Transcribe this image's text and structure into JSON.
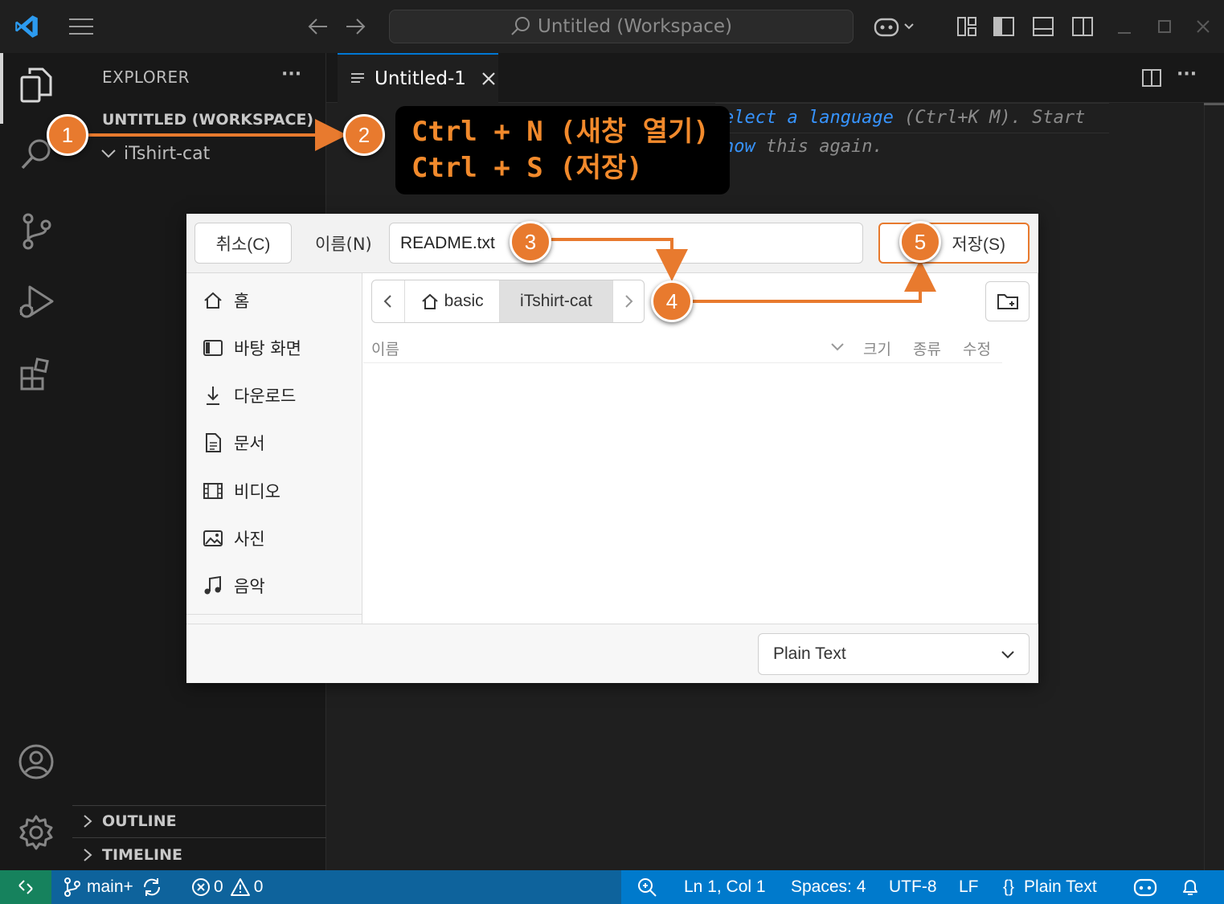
{
  "titlebar": {
    "search_text": "Untitled (Workspace)"
  },
  "sidebar": {
    "title": "EXPLORER",
    "more": "···",
    "workspace_label": "UNTITLED (WORKSPACE)",
    "folder": "iTshirt-cat",
    "outline": "OUTLINE",
    "timeline": "TIMELINE"
  },
  "editor": {
    "tab_label": "Untitled-1",
    "hint_line1_lang": "elect a language",
    "hint_line1_rest": " (Ctrl+K M). Start",
    "hint_line2_link": "how",
    "hint_line2_rest": " this again."
  },
  "dialog": {
    "cancel_label": "취소(C)",
    "name_label": "이름(N)",
    "filename": "README.txt",
    "save_label": "저장(S)",
    "places": [
      {
        "label": "홈",
        "icon": "home-icon"
      },
      {
        "label": "바탕 화면",
        "icon": "desktop-icon"
      },
      {
        "label": "다운로드",
        "icon": "download-icon"
      },
      {
        "label": "문서",
        "icon": "document-icon"
      },
      {
        "label": "비디오",
        "icon": "video-icon"
      },
      {
        "label": "사진",
        "icon": "picture-icon"
      },
      {
        "label": "음악",
        "icon": "music-icon"
      }
    ],
    "crumbs": [
      "basic",
      "iTshirt-cat"
    ],
    "columns": [
      "이름",
      "크기",
      "종류",
      "수정"
    ],
    "filter": "Plain Text"
  },
  "statusbar": {
    "branch": "main+",
    "errors": "0",
    "warnings": "0",
    "position": "Ln 1, Col 1",
    "spaces": "Spaces: 4",
    "encoding": "UTF-8",
    "eol": "LF",
    "language": "Plain Text"
  },
  "annotations": {
    "badges": [
      "1",
      "2",
      "3",
      "4",
      "5"
    ],
    "callout_line1": "Ctrl + N (새창 열기)",
    "callout_line2": "Ctrl + S (저장)",
    "color": "#e87a2e"
  }
}
